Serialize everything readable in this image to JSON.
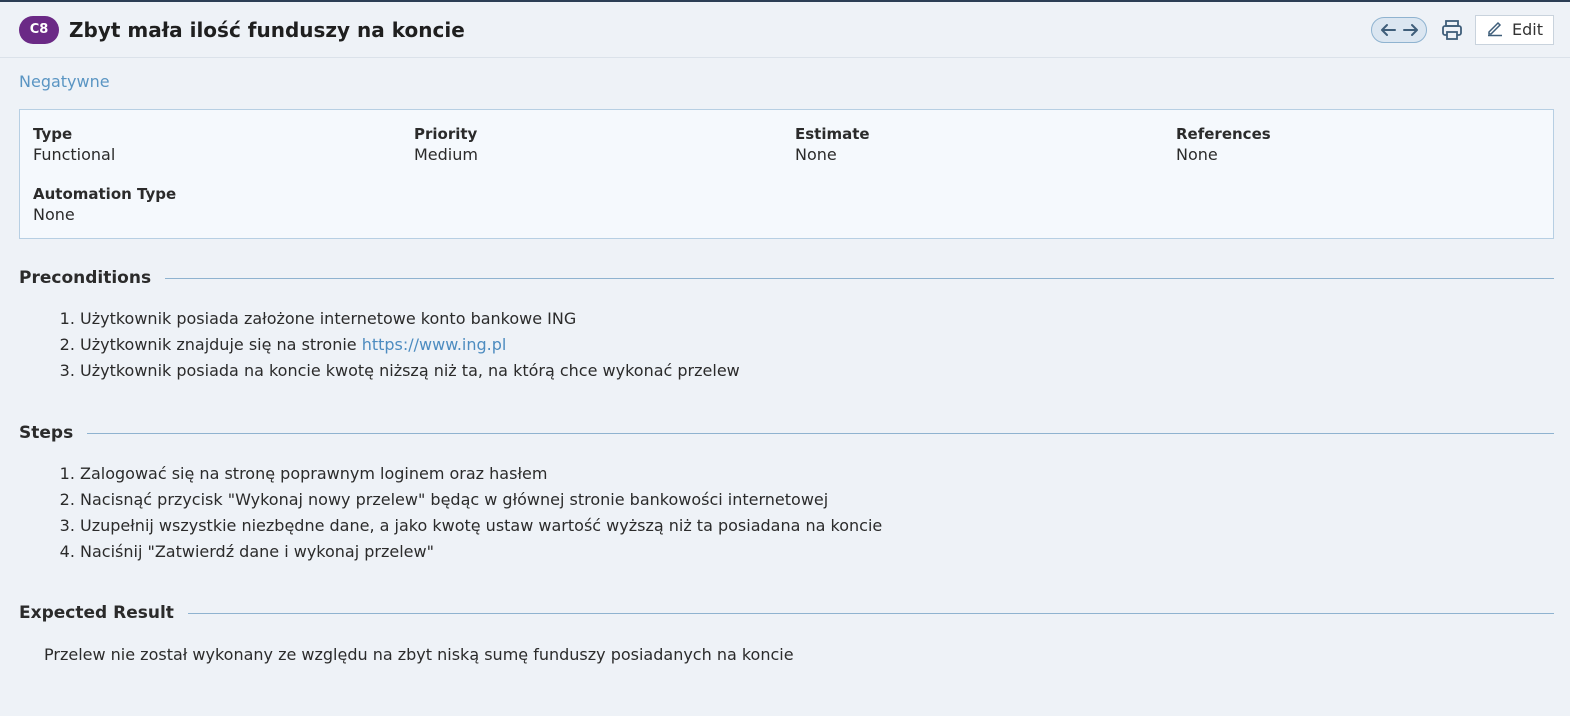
{
  "header": {
    "badge": "C8",
    "title": "Zbyt mała ilość funduszy na koncie",
    "edit_label": "Edit",
    "icons": [
      "arrow-left-icon",
      "arrow-right-icon",
      "printer-icon",
      "pencil-icon"
    ]
  },
  "section_tag": "Negatywne",
  "properties": {
    "type": {
      "label": "Type",
      "value": "Functional"
    },
    "priority": {
      "label": "Priority",
      "value": "Medium"
    },
    "estimate": {
      "label": "Estimate",
      "value": "None"
    },
    "references": {
      "label": "References",
      "value": "None"
    },
    "automation": {
      "label": "Automation Type",
      "value": "None"
    }
  },
  "preconditions": {
    "title": "Preconditions",
    "items": [
      "Użytkownik posiada założone internetowe konto bankowe ING",
      "Użytkownik znajduje się na stronie ",
      "Użytkownik posiada na koncie kwotę niższą niż ta, na którą chce wykonać przelew"
    ],
    "link": "https://www.ing.pl"
  },
  "steps": {
    "title": "Steps",
    "items": [
      "Zalogować się na stronę poprawnym loginem oraz hasłem",
      "Nacisnąć przycisk \"Wykonaj nowy przelew\" będąc w głównej stronie bankowości internetowej",
      "Uzupełnij wszystkie niezbędne dane, a jako kwotę ustaw wartość wyższą niż ta posiadana na koncie",
      "Naciśnij \"Zatwierdź dane i wykonaj przelew\""
    ]
  },
  "expected": {
    "title": "Expected Result",
    "text": "Przelew nie został wykonany ze względu na zbyt niską sumę funduszy posiadanych na koncie"
  },
  "colors": {
    "badge": "#6b2a86",
    "link": "#4d8cc0",
    "divider": "#8fb3d0",
    "background": "#eef2f7"
  }
}
